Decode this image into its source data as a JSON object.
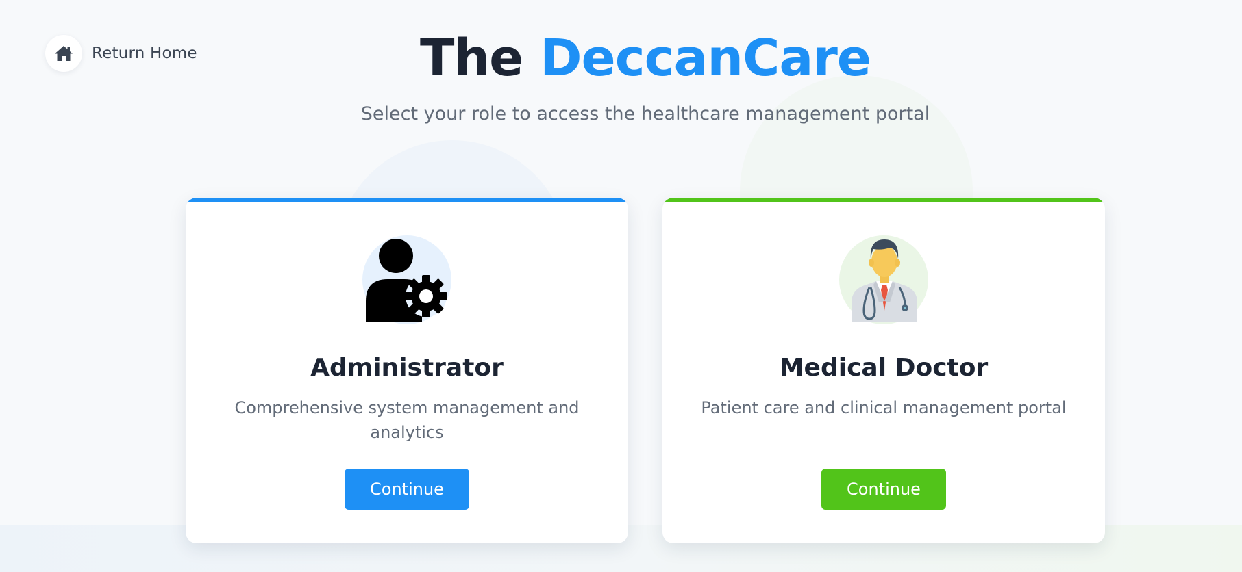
{
  "nav": {
    "return_home_label": "Return Home",
    "return_home_icon": "home-icon"
  },
  "header": {
    "title_prefix": "The",
    "title_brand": "DeccanCare",
    "subtitle": "Select your role to access the healthcare management portal"
  },
  "roles": [
    {
      "title": "Administrator",
      "description": "Comprehensive system management and analytics",
      "button_label": "Continue",
      "icon": "admin-gear-icon",
      "accent_color": "#1e90f5"
    },
    {
      "title": "Medical Doctor",
      "description": "Patient care and clinical management portal",
      "button_label": "Continue",
      "icon": "doctor-icon",
      "accent_color": "#52c41a"
    }
  ],
  "colors": {
    "brand_blue": "#1e90f5",
    "accent_green": "#52c41a",
    "heading": "#1c2433",
    "muted_text": "#626b78",
    "background": "#f7f9fb"
  }
}
